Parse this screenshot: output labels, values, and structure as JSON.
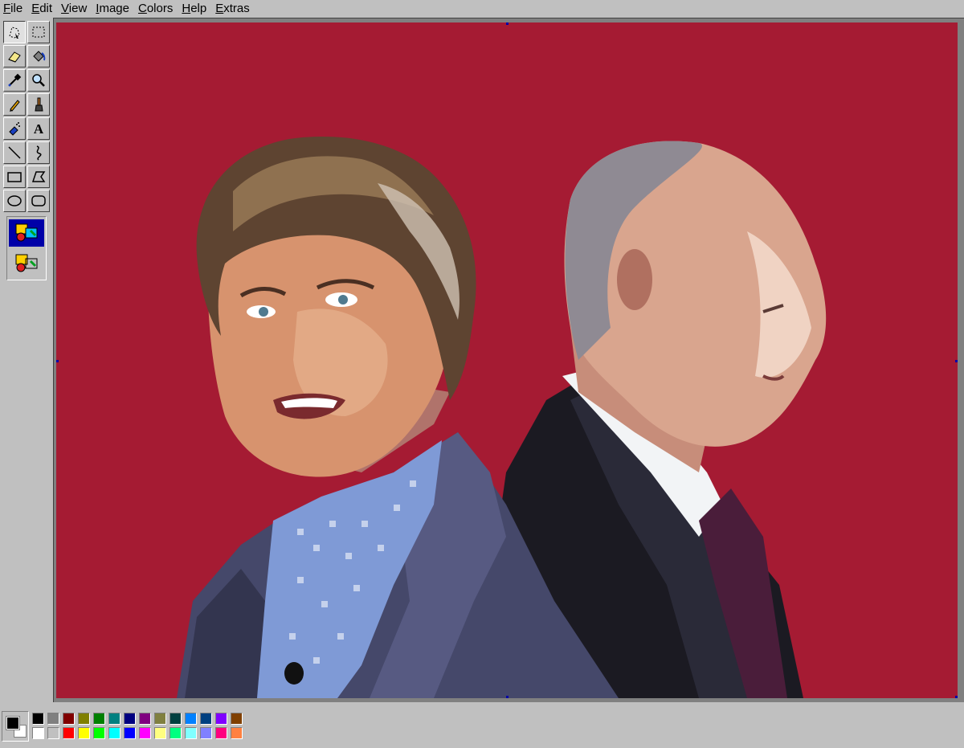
{
  "menu": [
    {
      "mnemonic": "F",
      "rest": "ile"
    },
    {
      "mnemonic": "E",
      "rest": "dit"
    },
    {
      "mnemonic": "V",
      "rest": "iew"
    },
    {
      "mnemonic": "I",
      "rest": "mage"
    },
    {
      "mnemonic": "C",
      "rest": "olors"
    },
    {
      "mnemonic": "H",
      "rest": "elp"
    },
    {
      "mnemonic": "E",
      "rest": "xtras"
    }
  ],
  "tools": [
    {
      "name": "free-form-select-tool",
      "icon": "free-form-select-icon",
      "active": true
    },
    {
      "name": "rect-select-tool",
      "icon": "rect-select-icon",
      "active": false
    },
    {
      "name": "eraser-tool",
      "icon": "eraser-icon",
      "active": false
    },
    {
      "name": "fill-tool",
      "icon": "paint-bucket-icon",
      "active": false
    },
    {
      "name": "pick-color-tool",
      "icon": "eyedropper-icon",
      "active": false
    },
    {
      "name": "magnifier-tool",
      "icon": "magnifier-icon",
      "active": false
    },
    {
      "name": "pencil-tool",
      "icon": "pencil-icon",
      "active": false
    },
    {
      "name": "brush-tool",
      "icon": "brush-icon",
      "active": false
    },
    {
      "name": "airbrush-tool",
      "icon": "airbrush-icon",
      "active": false
    },
    {
      "name": "text-tool",
      "icon": "text-icon",
      "active": false,
      "glyph": "A"
    },
    {
      "name": "line-tool",
      "icon": "line-icon",
      "active": false
    },
    {
      "name": "curve-tool",
      "icon": "curve-icon",
      "active": false
    },
    {
      "name": "rectangle-tool",
      "icon": "rectangle-icon",
      "active": false
    },
    {
      "name": "polygon-tool",
      "icon": "polygon-icon",
      "active": false
    },
    {
      "name": "ellipse-tool",
      "icon": "ellipse-icon",
      "active": false
    },
    {
      "name": "rounded-rectangle-tool",
      "icon": "rounded-rectangle-icon",
      "active": false
    }
  ],
  "tool_options": [
    {
      "name": "opaque-selection-option",
      "icon": "opaque-selection-icon",
      "selected": true
    },
    {
      "name": "transparent-selection-option",
      "icon": "transparent-selection-icon",
      "selected": false
    }
  ],
  "canvas": {
    "background_color": "#a51b33"
  },
  "current_colors": {
    "foreground": "#000000",
    "background": "#ffffff"
  },
  "palette": [
    "#000000",
    "#808080",
    "#800000",
    "#808000",
    "#008000",
    "#008080",
    "#000080",
    "#800080",
    "#808040",
    "#004040",
    "#0080ff",
    "#004080",
    "#8000ff",
    "#804000",
    "#ffffff",
    "#c0c0c0",
    "#ff0000",
    "#ffff00",
    "#00ff00",
    "#00ffff",
    "#0000ff",
    "#ff00ff",
    "#ffff80",
    "#00ff80",
    "#80ffff",
    "#8080ff",
    "#ff0080",
    "#ff8040"
  ]
}
